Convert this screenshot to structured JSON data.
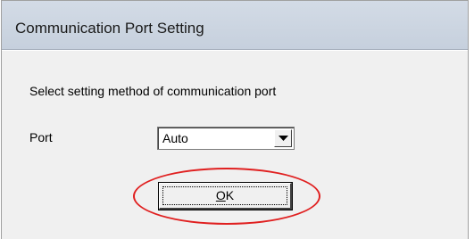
{
  "window": {
    "title": "Communication Port Setting"
  },
  "content": {
    "instruction": "Select setting method of communication port",
    "port_label": "Port",
    "port_select": {
      "value": "Auto",
      "icon": "chevron-down-icon"
    },
    "ok_button": {
      "accel": "O",
      "rest": "K"
    }
  },
  "annotation": {
    "highlight_color": "#e02020",
    "shape": "ellipse"
  }
}
